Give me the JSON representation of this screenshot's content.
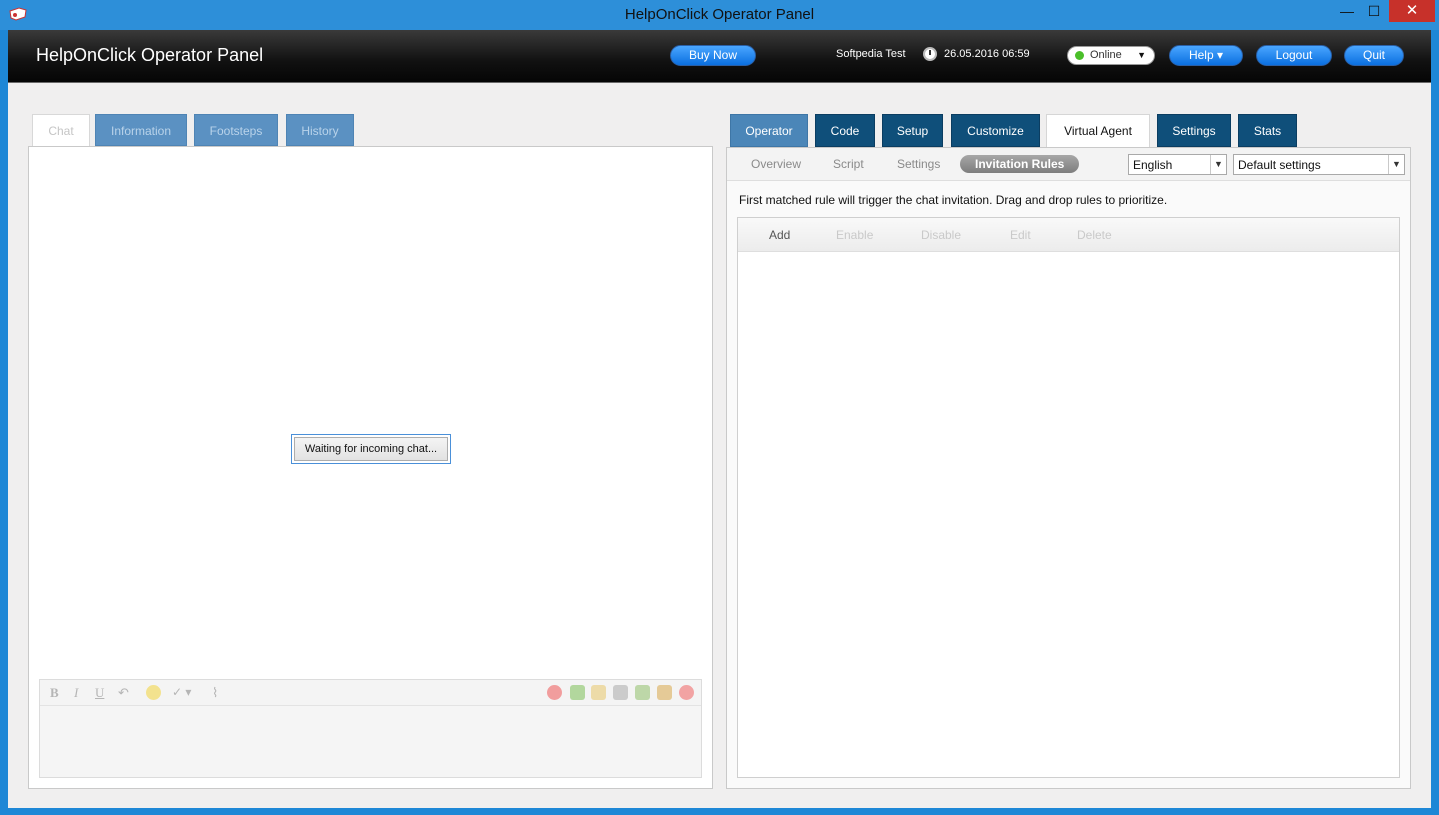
{
  "window": {
    "title": "HelpOnClick Operator Panel",
    "minimize": "—",
    "maximize": "☐",
    "close": "✕"
  },
  "header": {
    "brand": "HelpOnClick Operator Panel",
    "buy_now": "Buy Now",
    "user": "Softpedia Test",
    "datetime": "26.05.2016 06:59",
    "status": "Online",
    "help": "Help ▾",
    "logout": "Logout",
    "quit": "Quit"
  },
  "left": {
    "tabs": [
      "Chat",
      "Information",
      "Footsteps",
      "History"
    ],
    "waiting": "Waiting for incoming chat...",
    "format": {
      "bold": "B",
      "italic": "I",
      "underline": "U"
    }
  },
  "right": {
    "tabs": [
      "Operator",
      "Code",
      "Setup",
      "Customize",
      "Virtual Agent",
      "Settings",
      "Stats"
    ],
    "subtabs": [
      "Overview",
      "Script",
      "Settings",
      "Invitation Rules"
    ],
    "language": "English",
    "preset": "Default settings",
    "note": "First matched rule will trigger the chat invitation. Drag and drop rules to prioritize.",
    "actions": [
      "Add",
      "Enable",
      "Disable",
      "Edit",
      "Delete"
    ]
  },
  "colors": {
    "accent": "#1e87d6",
    "tab_dark": "#0f4f7a",
    "tab_light": "#5b91c2",
    "online": "#4bbf2a",
    "close": "#c7312a"
  }
}
